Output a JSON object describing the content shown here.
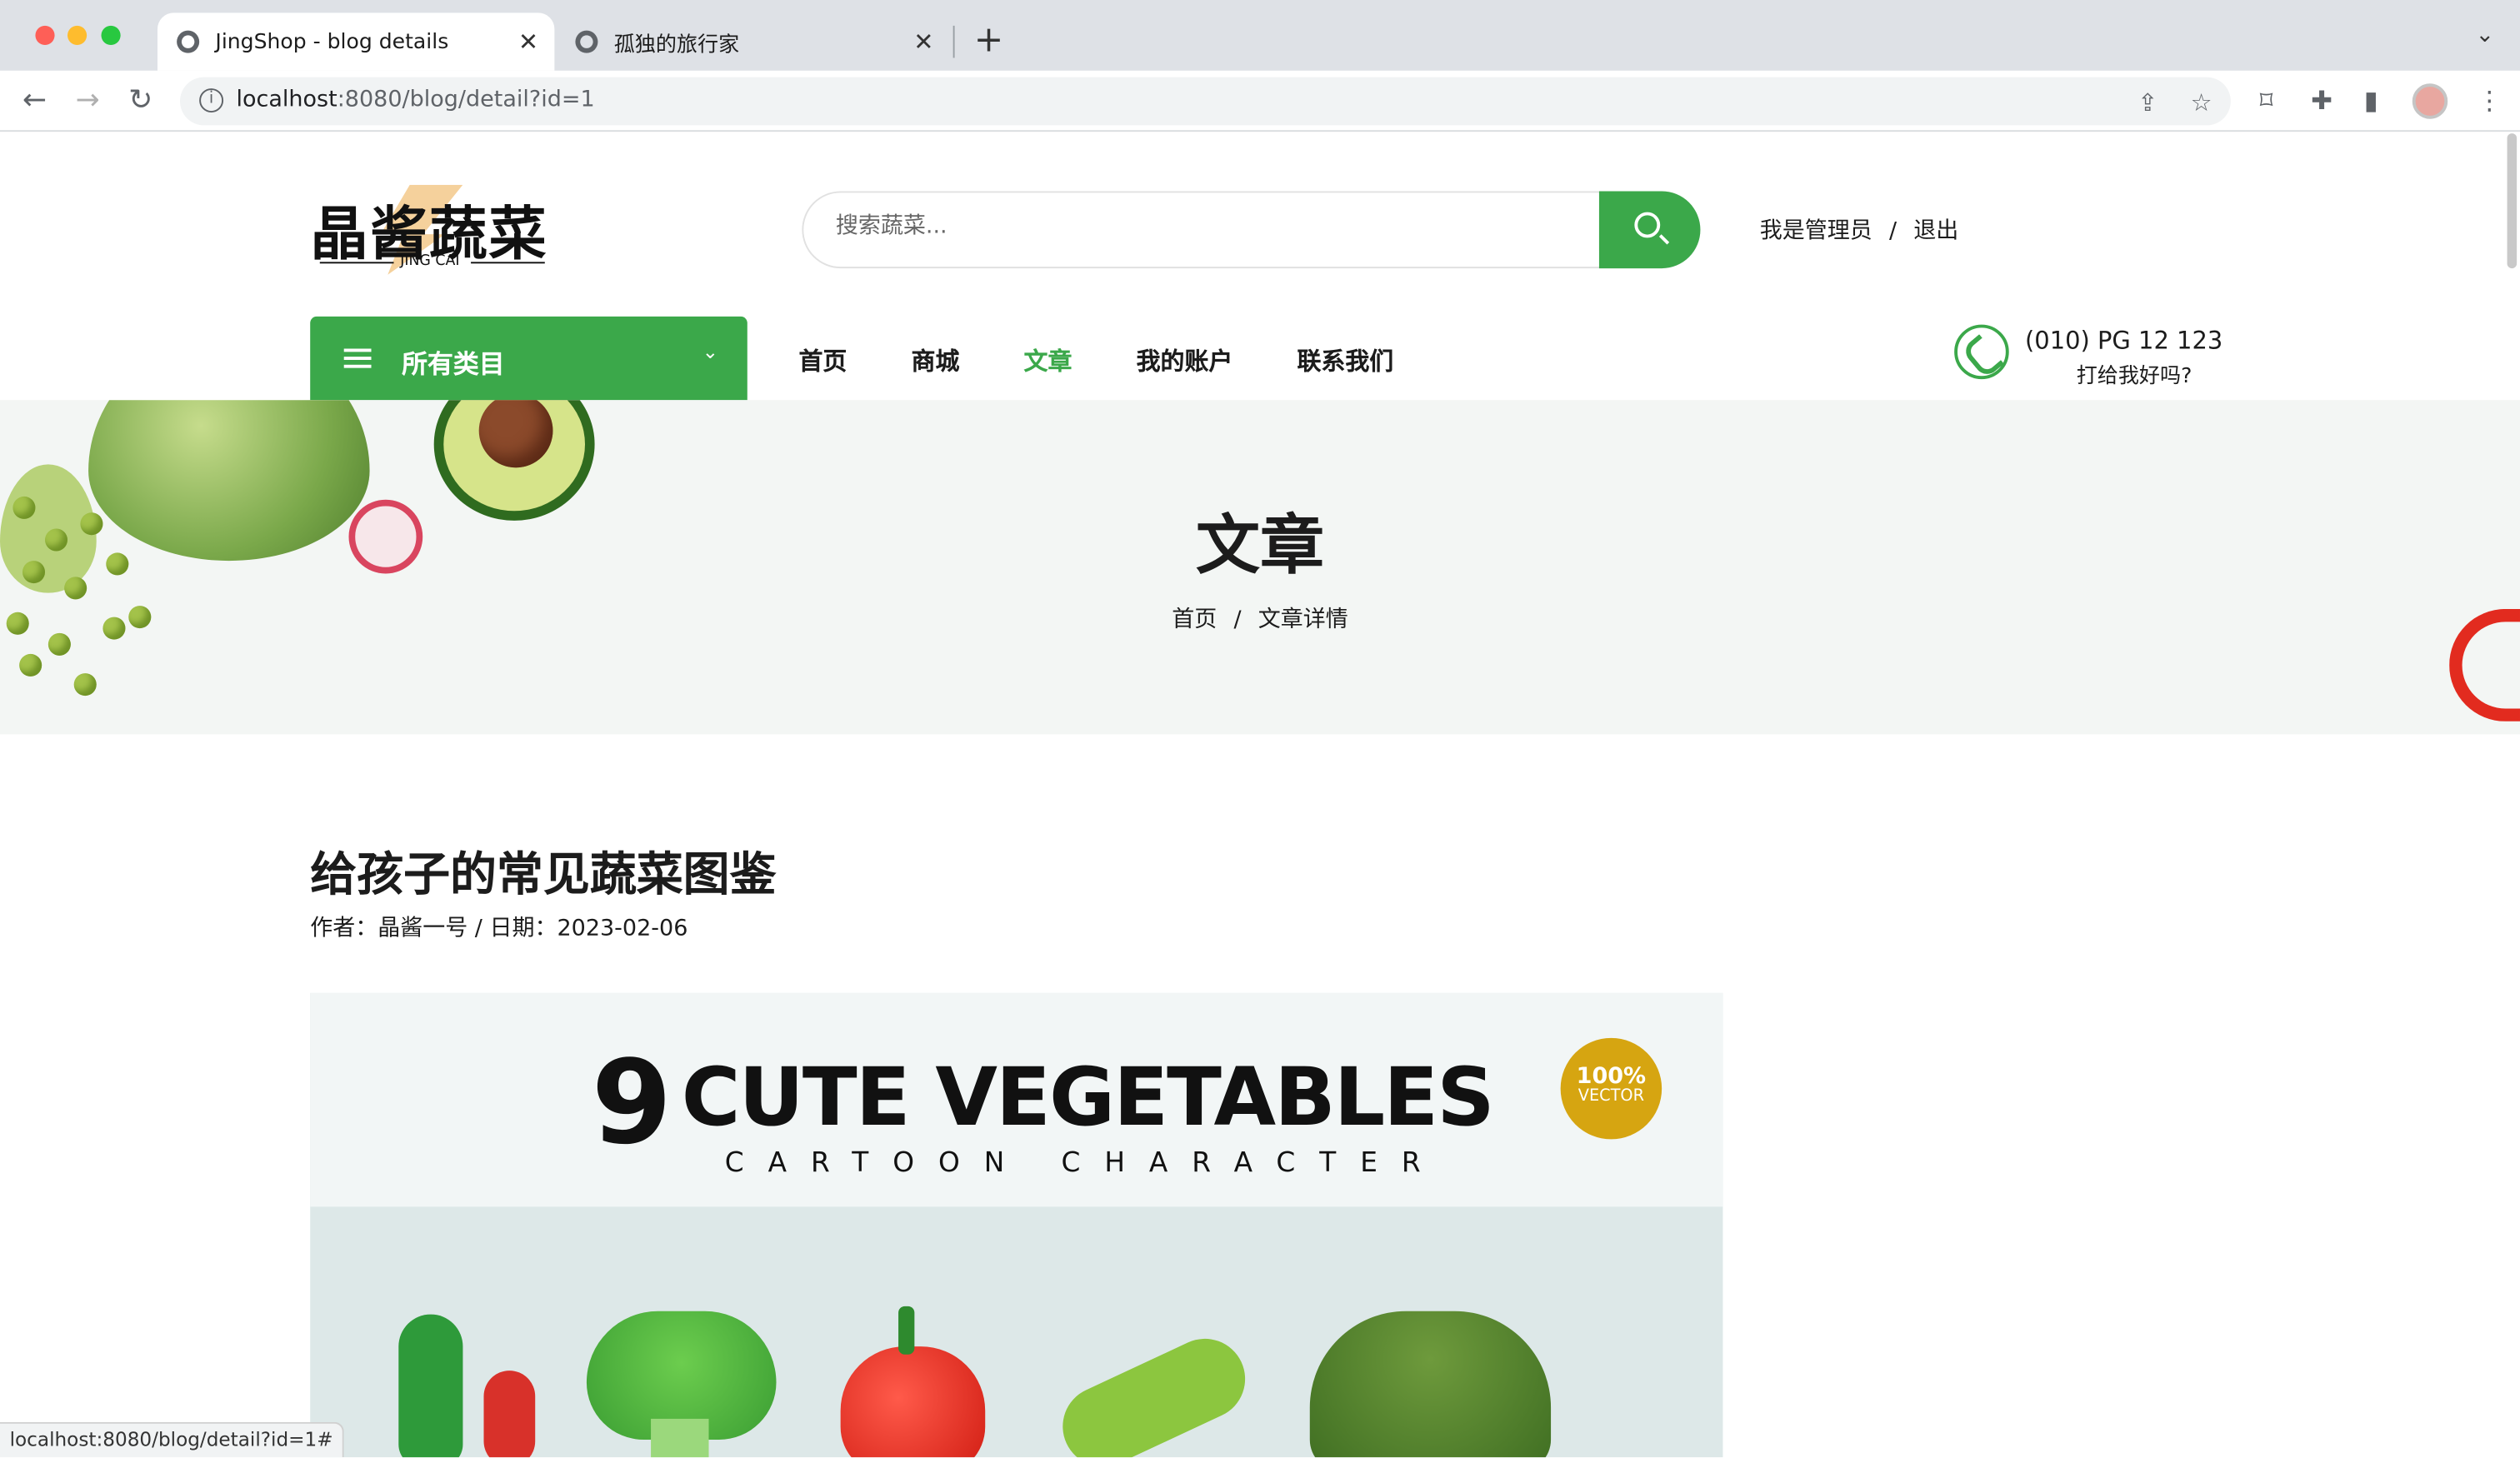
{
  "browser": {
    "tabs": [
      {
        "title": "JingShop - blog details",
        "active": true
      },
      {
        "title": "孤独的旅行家",
        "active": false
      }
    ],
    "url_host": "localhost",
    "url_rest": ":8080/blog/detail?id=1",
    "status_url": "localhost:8080/blog/detail?id=1#"
  },
  "header": {
    "logo_cn": "晶酱蔬菜",
    "logo_en": "JING CAI",
    "search_placeholder": "搜索蔬菜...",
    "account_user": "我是管理员",
    "account_sep": "/",
    "account_logout": "退出"
  },
  "nav": {
    "categories_label": "所有类目",
    "items": [
      "首页",
      "商城",
      "文章",
      "我的账户",
      "联系我们"
    ],
    "active": "文章",
    "phone_number": "(010) PG 12 123",
    "phone_sub": "打给我好吗?"
  },
  "hero": {
    "title": "文章",
    "crumb_home": "首页",
    "crumb_sep": "/",
    "crumb_current": "文章详情"
  },
  "article": {
    "title": "给孩子的常见蔬菜图鉴",
    "meta": "作者：晶酱一号 / 日期：2023-02-06",
    "poster": {
      "number": "9",
      "headline": "CUTE VEGETABLES",
      "subline": "CARTOON CHARACTER",
      "badge_top": "100%",
      "badge_bottom": "VECTOR"
    }
  },
  "colors": {
    "accent": "#3ba84a",
    "badge": "#d6a511"
  }
}
